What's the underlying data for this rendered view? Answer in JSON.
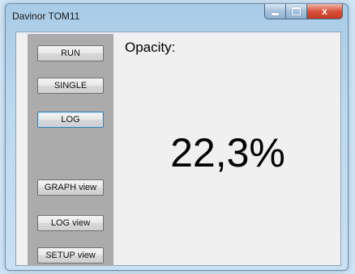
{
  "window": {
    "title": "Davinor TOM11",
    "close_glyph": "x"
  },
  "sidebar": {
    "buttons": [
      {
        "label": "RUN"
      },
      {
        "label": "SINGLE"
      },
      {
        "label": "LOG"
      },
      {
        "label": "GRAPH view"
      },
      {
        "label": "LOG view"
      },
      {
        "label": "SETUP view"
      }
    ]
  },
  "main": {
    "opacity_label": "Opacity:",
    "opacity_value": "22,3%"
  },
  "colors": {
    "sidebar_bg": "#ababab",
    "client_bg": "#f0f0f0",
    "close_button": "#c23a22"
  }
}
